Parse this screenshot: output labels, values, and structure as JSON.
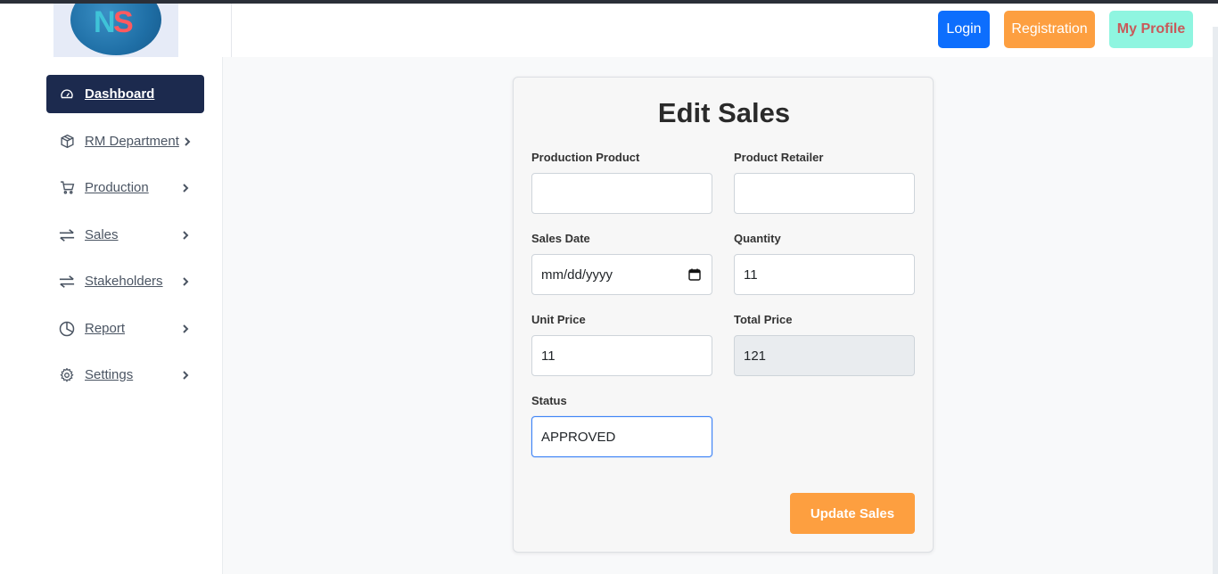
{
  "header": {
    "logo_text": "NS",
    "login_label": "Login",
    "registration_label": "Registration",
    "profile_label": "My Profile"
  },
  "sidebar": {
    "items": [
      {
        "label": "Dashboard",
        "icon": "gauge-icon",
        "active": true,
        "chevron": false
      },
      {
        "label": "RM Department",
        "icon": "box-icon",
        "active": false,
        "chevron": true
      },
      {
        "label": "Production",
        "icon": "cart-icon",
        "active": false,
        "chevron": true
      },
      {
        "label": "Sales",
        "icon": "arrows-exchange-icon",
        "active": false,
        "chevron": true
      },
      {
        "label": "Stakeholders",
        "icon": "arrows-exchange-icon",
        "active": false,
        "chevron": true
      },
      {
        "label": "Report",
        "icon": "pie-chart-icon",
        "active": false,
        "chevron": true
      },
      {
        "label": "Settings",
        "icon": "gear-icon",
        "active": false,
        "chevron": true
      }
    ]
  },
  "form": {
    "title": "Edit Sales",
    "fields": {
      "production_product": {
        "label": "Production Product",
        "value": ""
      },
      "product_retailer": {
        "label": "Product Retailer",
        "value": ""
      },
      "sales_date": {
        "label": "Sales Date",
        "value": "mm/dd/yyyy"
      },
      "quantity": {
        "label": "Quantity",
        "value": "11"
      },
      "unit_price": {
        "label": "Unit Price",
        "value": "11"
      },
      "total_price": {
        "label": "Total Price",
        "value": "121"
      },
      "status": {
        "label": "Status",
        "value": "APPROVED"
      }
    },
    "submit_label": "Update Sales"
  },
  "colors": {
    "primary": "#0d6efd",
    "accent_orange": "#fd9f40",
    "profile_bg": "#8ff5e0",
    "sidebar_active": "#1c2a4e"
  }
}
